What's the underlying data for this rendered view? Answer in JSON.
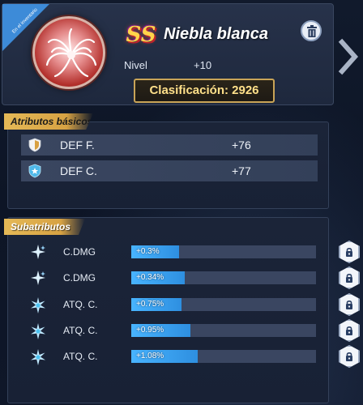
{
  "header": {
    "ribbon_text": "En el inventario",
    "rarity": "SS",
    "item_name": "Niebla blanca",
    "level_label": "Nivel",
    "level_value": "+10",
    "rating_text": "Clasificación: 2926"
  },
  "basic_attributes": {
    "title": "Atributos básicos",
    "rows": [
      {
        "icon": "shield-half-icon",
        "label": "DEF F.",
        "value": "+76"
      },
      {
        "icon": "shield-star-icon",
        "label": "DEF C.",
        "value": "+77"
      }
    ]
  },
  "sub_attributes": {
    "title": "Subatributos",
    "rows": [
      {
        "icon": "sparkle-icon",
        "label": "C.DMG",
        "value": "+0.3%",
        "level": 0.26
      },
      {
        "icon": "sparkle-icon",
        "label": "C.DMG",
        "value": "+0.34%",
        "level": 0.29
      },
      {
        "icon": "star-burst-icon",
        "label": "ATQ. C.",
        "value": "+0.75%",
        "level": 0.27
      },
      {
        "icon": "star-burst-icon",
        "label": "ATQ. C.",
        "value": "+0.95%",
        "level": 0.32
      },
      {
        "icon": "star-burst-icon",
        "label": "ATQ. C.",
        "value": "+1.08%",
        "level": 0.36
      }
    ]
  },
  "colors": {
    "accent_gold": "#d7a243",
    "bar_blue": "#48b4ff",
    "rating_text": "#ffe08a"
  }
}
